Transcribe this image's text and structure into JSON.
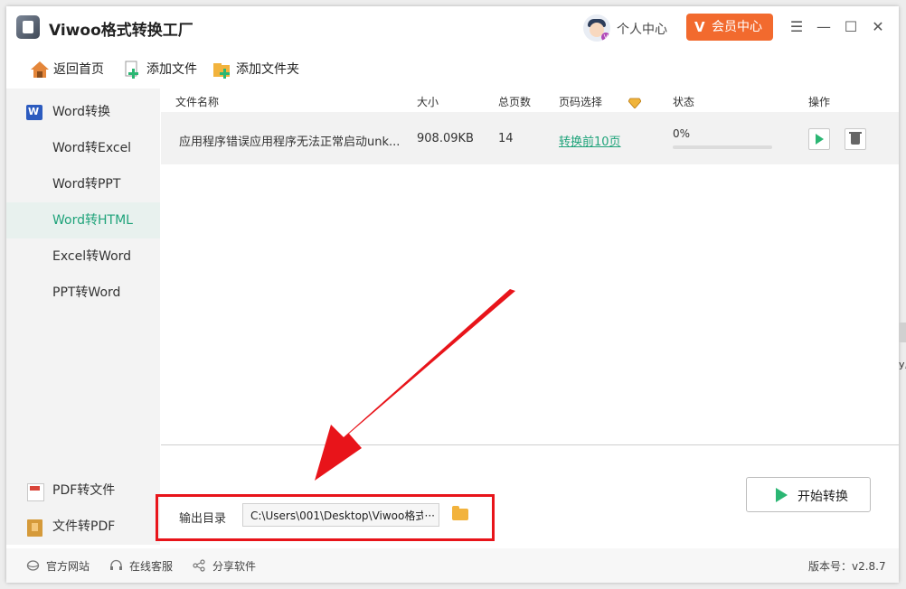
{
  "app": {
    "title": "Viwoo格式转换工厂"
  },
  "header": {
    "personal_center": "个人中心",
    "vip_center": "会员中心",
    "vip_icon": "V"
  },
  "window_controls": {
    "menu": "☰",
    "minimize": "—",
    "maximize": "☐",
    "close": "✕"
  },
  "toolbar": {
    "home": "返回首页",
    "add_file": "添加文件",
    "add_folder": "添加文件夹"
  },
  "sidebar": {
    "section": "Word转换",
    "items": [
      {
        "label": "Word转Excel",
        "active": false
      },
      {
        "label": "Word转PPT",
        "active": false
      },
      {
        "label": "Word转HTML",
        "active": true
      },
      {
        "label": "Excel转Word",
        "active": false
      },
      {
        "label": "PPT转Word",
        "active": false
      }
    ],
    "lower": [
      {
        "label": "PDF转文件"
      },
      {
        "label": "文件转PDF"
      }
    ]
  },
  "table": {
    "headers": {
      "name": "文件名称",
      "size": "大小",
      "pages": "总页数",
      "page_select": "页码选择",
      "status": "状态",
      "action": "操作"
    },
    "rows": [
      {
        "name": "应用程序错误应用程序无法正常启动unk...",
        "size": "908.09KB",
        "pages": "14",
        "page_select": "转换前10页",
        "progress_text": "0%",
        "progress": 0
      }
    ]
  },
  "output": {
    "label": "输出目录",
    "path": "C:\\Users\\001\\Desktop\\Viwoo格式",
    "overflow": "···"
  },
  "start_button": {
    "label": "开始转换"
  },
  "footer": {
    "website": "官方网站",
    "support": "在线客服",
    "share": "分享软件",
    "version": "版本号：v2.8.7"
  },
  "edge": {
    "text": "y,"
  },
  "colors": {
    "accent": "#1fa37a",
    "vip": "#f26a2e",
    "annotation": "#e8141a"
  }
}
